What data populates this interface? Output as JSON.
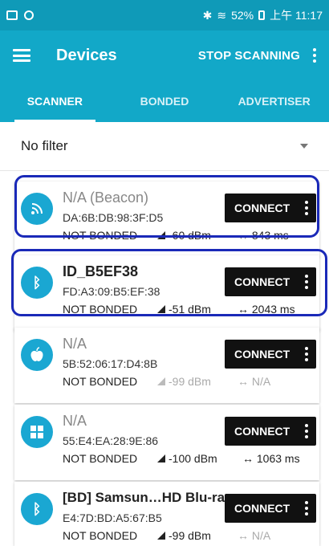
{
  "status": {
    "left_icons": [
      "gallery-icon",
      "vr-icon"
    ],
    "right_text": "52%",
    "time": "上午 11:17"
  },
  "appbar": {
    "title": "Devices",
    "action": "STOP SCANNING"
  },
  "tabs": [
    {
      "label": "SCANNER",
      "active": true
    },
    {
      "label": "BONDED",
      "active": false
    },
    {
      "label": "ADVERTISER",
      "active": false
    }
  ],
  "filter": {
    "label": "No filter"
  },
  "devices": [
    {
      "icon": "wifi-beacon-icon",
      "name": "N/A  (Beacon)",
      "address": "DA:6B:DB:98:3F:D5",
      "bond": "NOT BONDED",
      "rssi": "-60 dBm",
      "interval": "↔ 843 ms",
      "connect": "CONNECT",
      "muted": false
    },
    {
      "icon": "bluetooth-icon",
      "name": "ID_B5EF38",
      "address": "FD:A3:09:B5:EF:38",
      "bond": "NOT BONDED",
      "rssi": "-51 dBm",
      "interval": "↔ 2043 ms",
      "connect": "CONNECT",
      "muted": false
    },
    {
      "icon": "apple-icon",
      "name": "N/A",
      "address": "5B:52:06:17:D4:8B",
      "bond": "NOT BONDED",
      "rssi": "-99 dBm",
      "interval": "↔ N/A",
      "connect": "CONNECT",
      "muted": true
    },
    {
      "icon": "windows-icon",
      "name": "N/A",
      "address": "55:E4:EA:28:9E:86",
      "bond": "NOT BONDED",
      "rssi": "-100 dBm",
      "interval": "↔ 1063 ms",
      "connect": "CONNECT",
      "muted": false
    },
    {
      "icon": "bluetooth-icon",
      "name": "[BD] Samsun…HD Blu-ray",
      "address": "E4:7D:BD:A5:67:B5",
      "bond": "NOT BONDED",
      "rssi": "-99 dBm",
      "interval": "↔ N/A",
      "connect": "CONNECT",
      "muted": true
    }
  ],
  "colors": {
    "primary": "#12a8c8",
    "status_bar": "#0f9ab8",
    "icon_blue": "#1aa7d2",
    "highlight": "#1a29b8",
    "connect_bg": "#111111"
  }
}
